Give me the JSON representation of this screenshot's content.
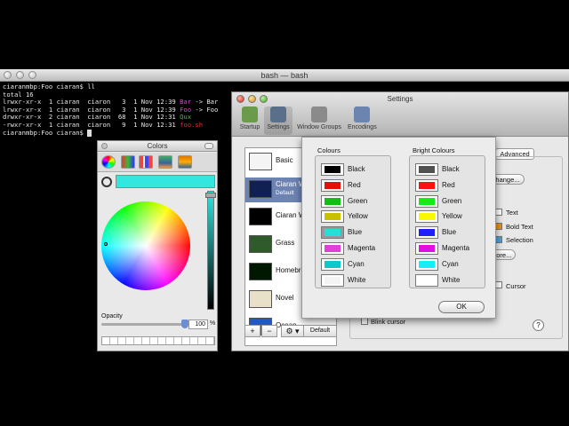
{
  "bash": {
    "title": "bash — bash",
    "lines": [
      [
        {
          "t": "ciaranmbp:Foo ciaran$ ll",
          "c": ""
        }
      ],
      [
        {
          "t": "total 16",
          "c": ""
        }
      ],
      [
        {
          "t": "lrwxr-xr-x  1 ciaran  ciaron   3  1 Nov 12:39 ",
          "c": ""
        },
        {
          "t": "Bar",
          "c": "mg"
        },
        {
          "t": " -> Bar",
          "c": ""
        }
      ],
      [
        {
          "t": "lrwxr-xr-x  1 ciaran  ciaron   3  1 Nov 12:39 ",
          "c": ""
        },
        {
          "t": "Foo",
          "c": "mg"
        },
        {
          "t": " -> Foo",
          "c": ""
        }
      ],
      [
        {
          "t": "drwxr-xr-x  2 ciaran  ciaron  68  1 Nov 12:31 ",
          "c": ""
        },
        {
          "t": "Qux",
          "c": "gr"
        }
      ],
      [
        {
          "t": "-rwxr-xr-x  1 ciaran  ciaron   9  1 Nov 12:31 ",
          "c": ""
        },
        {
          "t": "foo.sh",
          "c": "rd"
        }
      ],
      [
        {
          "t": "ciaranmbp:Foo ciaran$ ",
          "c": ""
        }
      ]
    ]
  },
  "colors_panel": {
    "title": "Colors",
    "tools": [
      "color-wheel",
      "color-sliders",
      "color-palettes",
      "image-palettes",
      "crayons"
    ],
    "current_color": "#33e6e0",
    "opacity_label": "Opacity",
    "opacity_value": "100",
    "opacity_fraction": 1.0,
    "opacity_unit": "%"
  },
  "settings": {
    "title": "Settings",
    "toolbar": [
      {
        "label": "Startup",
        "icon": "startup-icon",
        "color": "#6a9a4a"
      },
      {
        "label": "Settings",
        "icon": "settings-icon",
        "color": "#5a6f8a"
      },
      {
        "label": "Window Groups",
        "icon": "window-groups-icon",
        "color": "#8a8a8a"
      },
      {
        "label": "Encodings",
        "icon": "encodings-icon",
        "color": "#6b84b0"
      }
    ],
    "profiles": [
      {
        "name": "Basic",
        "thumb": "#f4f4f4"
      },
      {
        "name": "Ciaran W",
        "sub": "Default",
        "thumb": "#102050"
      },
      {
        "name": "Ciaran W",
        "thumb": "#000000"
      },
      {
        "name": "Grass",
        "thumb": "#2f5a2a"
      },
      {
        "name": "Homebre",
        "thumb": "#001800"
      },
      {
        "name": "Novel",
        "thumb": "#e8e0c8"
      },
      {
        "name": "Ocean",
        "thumb": "#2456c8"
      }
    ],
    "list_buttons": {
      "add": "+",
      "remove": "−",
      "gear": "⚙ ▾",
      "default": "Default"
    },
    "advanced_tab": "Advanced",
    "right_items": {
      "change": "Change...",
      "text": "Text",
      "bold_text": "Bold Text",
      "selection": "Selection",
      "more": "More...",
      "cursor": "Cursor",
      "blink_cursor": "Blink cursor"
    },
    "help": "?"
  },
  "colour_sheet": {
    "colours_title": "Colours",
    "bright_title": "Bright Colours",
    "colours": [
      {
        "name": "Black",
        "hex": "#000000"
      },
      {
        "name": "Red",
        "hex": "#e01010"
      },
      {
        "name": "Green",
        "hex": "#10c010"
      },
      {
        "name": "Yellow",
        "hex": "#c8c000"
      },
      {
        "name": "Blue",
        "hex": "#20e0d8",
        "selected": true
      },
      {
        "name": "Magenta",
        "hex": "#e040d8"
      },
      {
        "name": "Cyan",
        "hex": "#10c8c8"
      },
      {
        "name": "White",
        "hex": "#f4f4f4"
      }
    ],
    "bright_colours": [
      {
        "name": "Black",
        "hex": "#505050"
      },
      {
        "name": "Red",
        "hex": "#ff1010"
      },
      {
        "name": "Green",
        "hex": "#10f010"
      },
      {
        "name": "Yellow",
        "hex": "#f8f800"
      },
      {
        "name": "Blue",
        "hex": "#2020f8"
      },
      {
        "name": "Magenta",
        "hex": "#e010e0"
      },
      {
        "name": "Cyan",
        "hex": "#10f0f8"
      },
      {
        "name": "White",
        "hex": "#ffffff"
      }
    ],
    "ok_label": "OK"
  }
}
